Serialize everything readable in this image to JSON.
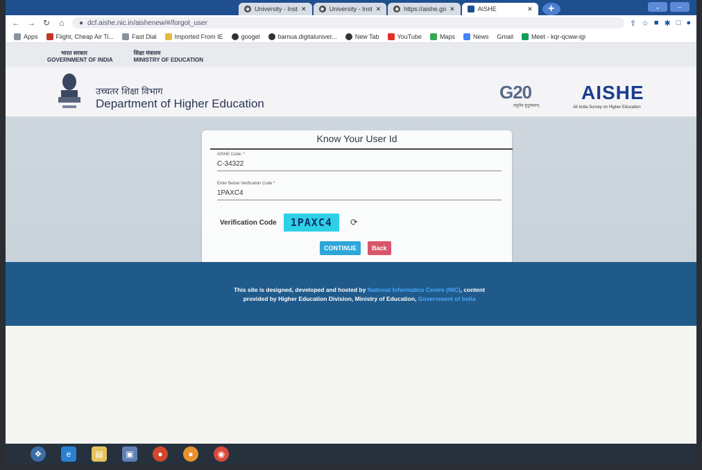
{
  "browser": {
    "tabs": [
      {
        "label": "University - Inst",
        "active": false
      },
      {
        "label": "University - Inst",
        "active": false
      },
      {
        "label": "https://aishe.go",
        "active": false
      },
      {
        "label": "AISHE",
        "active": true
      }
    ],
    "url": "dcf.aishe.nic.in/aishenew/#/forgot_user",
    "bookmarks": [
      "Apps",
      "Flight, Cheap Air Ti...",
      "Fast Dial",
      "Imported From IE",
      "googel",
      "bamua.digitaluniver...",
      "New Tab",
      "YouTube",
      "Maps",
      "News",
      "Gmail",
      "Meet - kqr-qcww-igi"
    ]
  },
  "gov": {
    "hindi_left": "भारत सरकार",
    "eng_left": "GOVERNMENT OF INDIA",
    "hindi_right": "शिक्षा मंत्रालय",
    "eng_right": "MINISTRY OF EDUCATION"
  },
  "header": {
    "dept_hindi": "उच्चतर शिक्षा विभाग",
    "dept_english": "Department of Higher Education",
    "g20": "G20",
    "g20_sub": "वसुधैव कुटुम्बकम्",
    "aishe": "AISHE",
    "aishe_sub": "All India Survey on Higher Education"
  },
  "form": {
    "title": "Know Your User Id",
    "aishe_code_label": "AISHE Code: *",
    "aishe_code_value": "C-34322",
    "verification_input_label": "Enter Below Verification Code *",
    "verification_input_value": "1PAXC4",
    "verification_label": "Verification Code",
    "captcha": "1PAXC4",
    "continue_label": "CONTINUE",
    "back_label": "Back"
  },
  "footer": {
    "line1_prefix": "This site is designed, developed and hosted by",
    "nic_link": "National Informatics Centre (NIC)",
    "line1_suffix": ", content",
    "line2_prefix": "provided by Higher Education Division, Ministry of Education,",
    "goi_link": "Government of India"
  },
  "colors": {
    "footer_bg": "#1f5a8a",
    "captcha_bg": "#2ed0e8",
    "continue_bg": "#2ea6d9",
    "back_bg": "#d9566a",
    "aishe_blue": "#1b3d8f"
  }
}
